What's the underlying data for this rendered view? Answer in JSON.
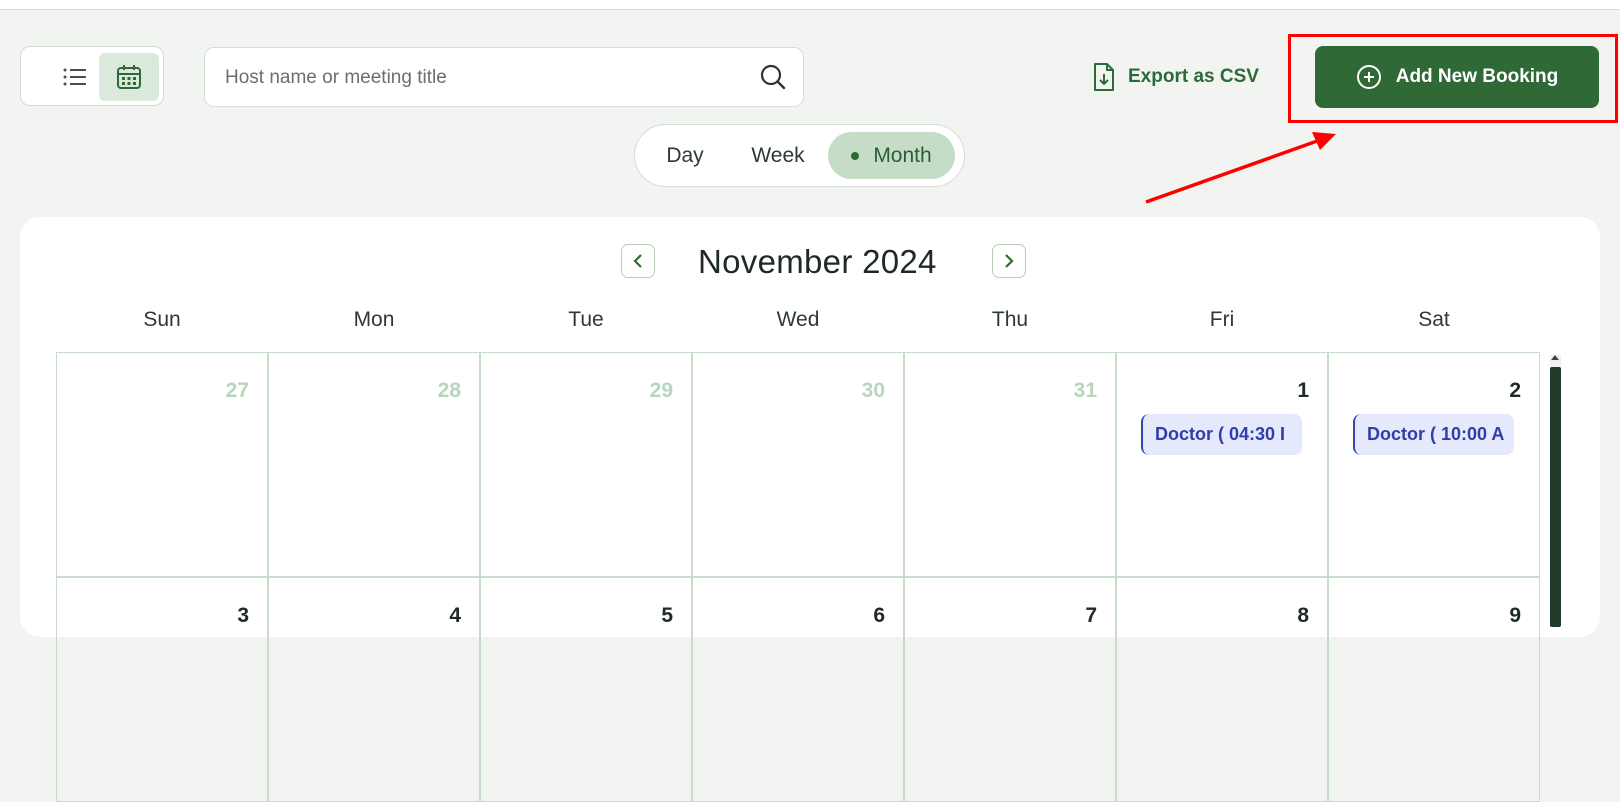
{
  "toolbar": {
    "view_toggle": {
      "list_icon": "list-icon",
      "calendar_icon": "calendar-icon",
      "active": "calendar"
    },
    "search": {
      "placeholder": "Host name or meeting title",
      "value": "",
      "icon": "search-icon"
    },
    "export_label": "Export as CSV",
    "export_icon": "file-download-icon",
    "add_label": "Add New Booking",
    "add_icon": "plus-circle-icon"
  },
  "range_toggle": {
    "items": [
      "Day",
      "Week",
      "Month"
    ],
    "active": "Month"
  },
  "calendar": {
    "title": "November 2024",
    "weekdays": [
      "Sun",
      "Mon",
      "Tue",
      "Wed",
      "Thu",
      "Fri",
      "Sat"
    ],
    "weeks": [
      [
        {
          "day": "27",
          "muted": true,
          "events": []
        },
        {
          "day": "28",
          "muted": true,
          "events": []
        },
        {
          "day": "29",
          "muted": true,
          "events": []
        },
        {
          "day": "30",
          "muted": true,
          "events": []
        },
        {
          "day": "31",
          "muted": true,
          "events": []
        },
        {
          "day": "1",
          "muted": false,
          "events": [
            "Doctor ( 04:30 I"
          ]
        },
        {
          "day": "2",
          "muted": false,
          "events": [
            "Doctor ( 10:00 A"
          ]
        }
      ],
      [
        {
          "day": "3",
          "muted": false,
          "events": []
        },
        {
          "day": "4",
          "muted": false,
          "events": []
        },
        {
          "day": "5",
          "muted": false,
          "events": []
        },
        {
          "day": "6",
          "muted": false,
          "events": []
        },
        {
          "day": "7",
          "muted": false,
          "events": []
        },
        {
          "day": "8",
          "muted": false,
          "events": []
        },
        {
          "day": "9",
          "muted": false,
          "events": []
        }
      ]
    ]
  },
  "colors": {
    "brand_green": "#2f6a36",
    "highlight_red": "#ff0000",
    "event_blue": "#2f3fa9",
    "muted_day": "#b9d5bd"
  }
}
